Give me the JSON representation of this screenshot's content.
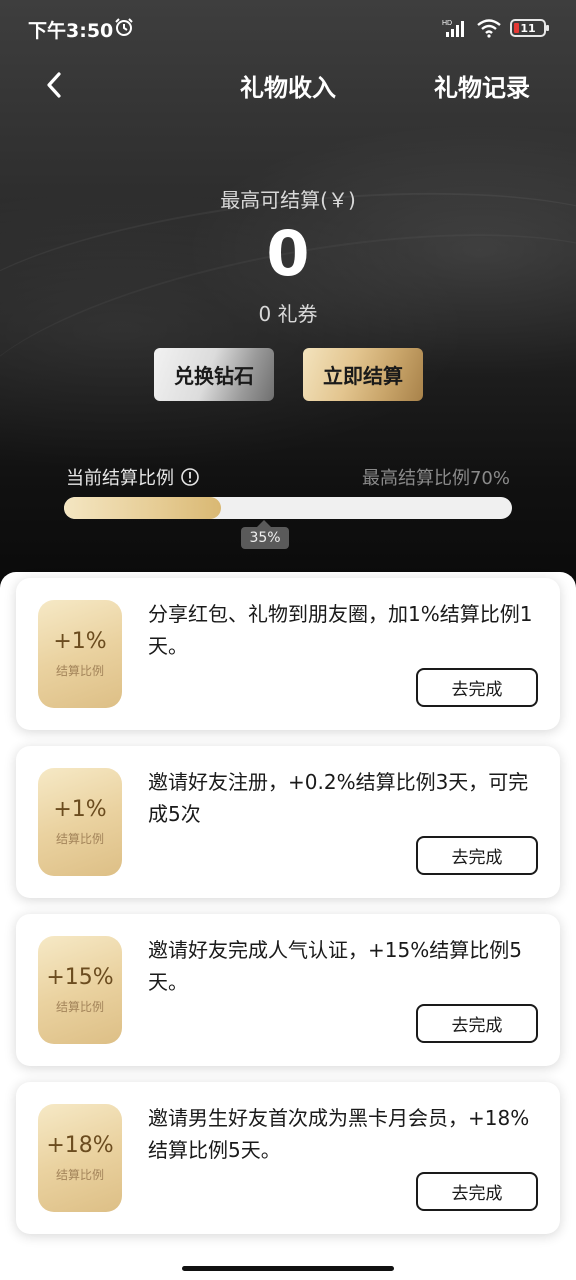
{
  "status_bar": {
    "time": "下午3:50",
    "battery": "11"
  },
  "nav": {
    "title": "礼物收入",
    "record": "礼物记录"
  },
  "summary": {
    "max_label": "最高可结算(￥)",
    "amount": "0",
    "coupons": "0 礼券"
  },
  "actions": {
    "exchange": "兑换钻石",
    "settle": "立即结算"
  },
  "ratio": {
    "label": "当前结算比例",
    "max": "最高结算比例70%",
    "current_percent": 35,
    "badge": "35%"
  },
  "tasks": [
    {
      "value": "+1%",
      "caption": "结算比例",
      "desc": "分享红包、礼物到朋友圈，加1%结算比例1天。",
      "button": "去完成"
    },
    {
      "value": "+1%",
      "caption": "结算比例",
      "desc": "邀请好友注册，+0.2%结算比例3天，可完成5次",
      "button": "去完成"
    },
    {
      "value": "+15%",
      "caption": "结算比例",
      "desc": "邀请好友完成人气认证，+15%结算比例5天。",
      "button": "去完成"
    },
    {
      "value": "+18%",
      "caption": "结算比例",
      "desc": "邀请男生好友首次成为黑卡月会员，+18%结算比例5天。",
      "button": "去完成"
    }
  ]
}
